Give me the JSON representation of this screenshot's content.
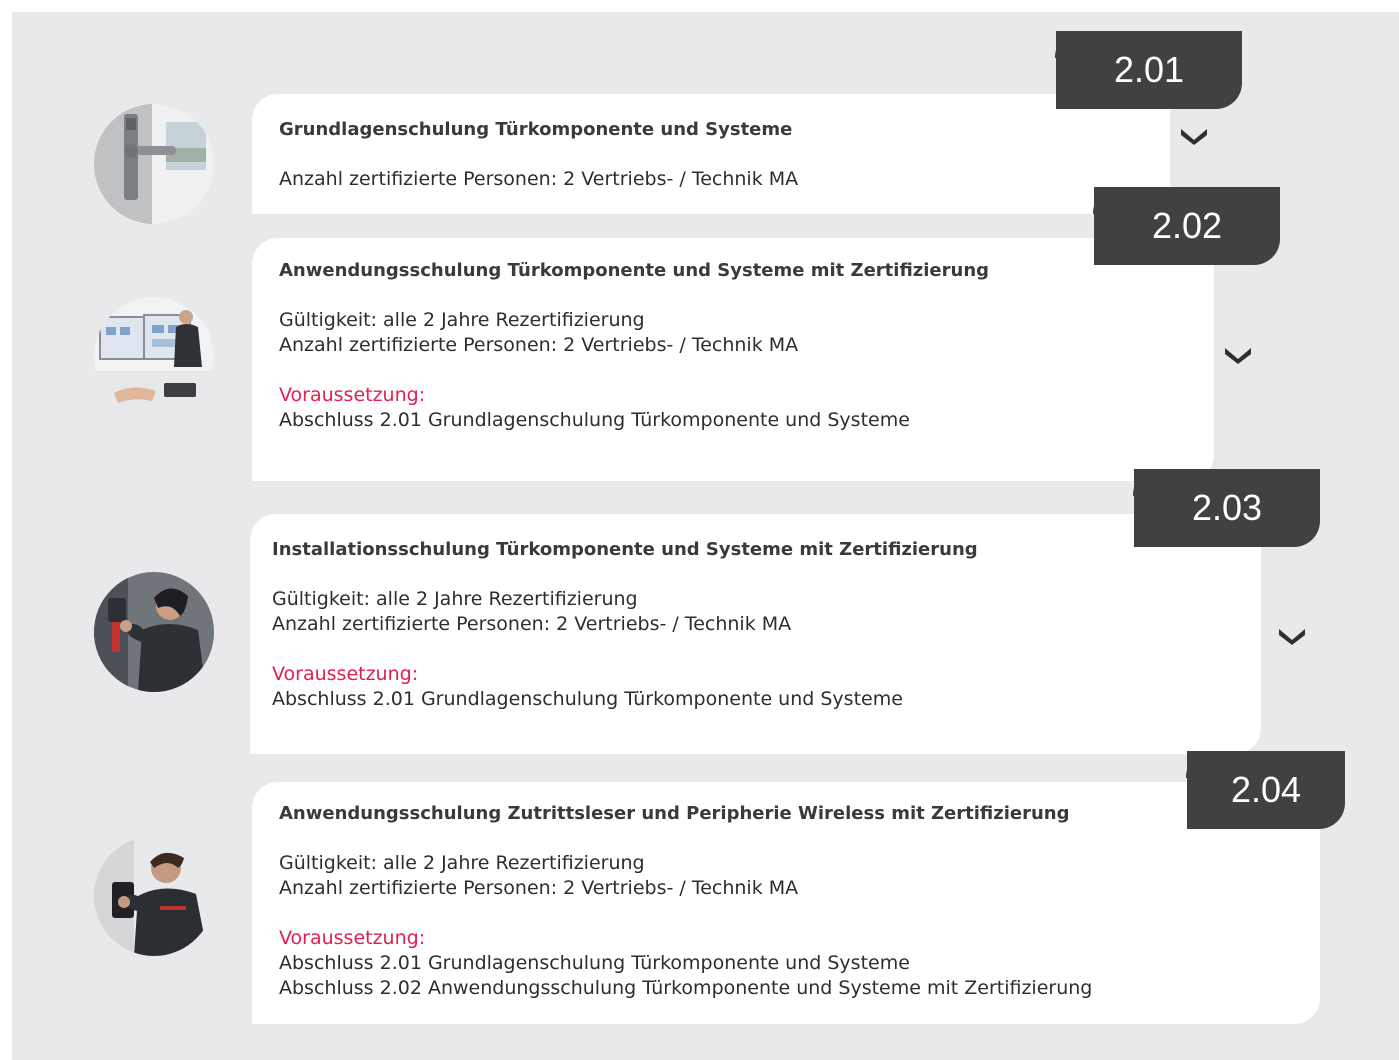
{
  "modules": [
    {
      "number": "2.01",
      "title": "Grundlagenschulung Türkomponente und Systeme",
      "lines": [
        "Anzahl zertifizierte Personen: 2 Vertriebs- / Technik MA"
      ],
      "requirement_label": "",
      "requirements": [],
      "image": "door-handle-photo"
    },
    {
      "number": "2.02",
      "title": "Anwendungsschulung Türkomponente und Systeme mit Zertifizierung",
      "lines": [
        "Gültigkeit: alle 2 Jahre Rezertifizierung",
        "Anzahl zertifizierte Personen: 2 Vertriebs- / Technik MA"
      ],
      "requirement_label": "Voraussetzung:",
      "requirements": [
        "Abschluss 2.01 Grundlagenschulung Türkomponente und Systeme"
      ],
      "image": "training-monitors-photo"
    },
    {
      "number": "2.03",
      "title": "Installationsschulung Türkomponente und Systeme mit Zertifizierung",
      "lines": [
        "Gültigkeit: alle 2 Jahre Rezertifizierung",
        "Anzahl zertifizierte Personen: 2 Vertriebs- / Technik MA"
      ],
      "requirement_label": "Voraussetzung:",
      "requirements": [
        "Abschluss 2.01 Grundlagenschulung Türkomponente und Systeme"
      ],
      "image": "installer-photo"
    },
    {
      "number": "2.04",
      "title": "Anwendungsschulung Zutrittsleser und Peripherie Wireless mit Zertifizierung",
      "lines": [
        "Gültigkeit: alle 2 Jahre Rezertifizierung",
        "Anzahl zertifizierte Personen: 2 Vertriebs- / Technik MA"
      ],
      "requirement_label": "Voraussetzung:",
      "requirements": [
        "Abschluss 2.01 Grundlagenschulung Türkomponente und Systeme",
        "Abschluss 2.02 Anwendungsschulung Türkomponente und Systeme mit Zertifizierung"
      ],
      "image": "wall-reader-photo"
    }
  ],
  "icons": {
    "expand": "chevron-down-icon"
  },
  "colors": {
    "badge": "#414141",
    "requirement": "#e0204f",
    "background": "#e9e9ec"
  }
}
